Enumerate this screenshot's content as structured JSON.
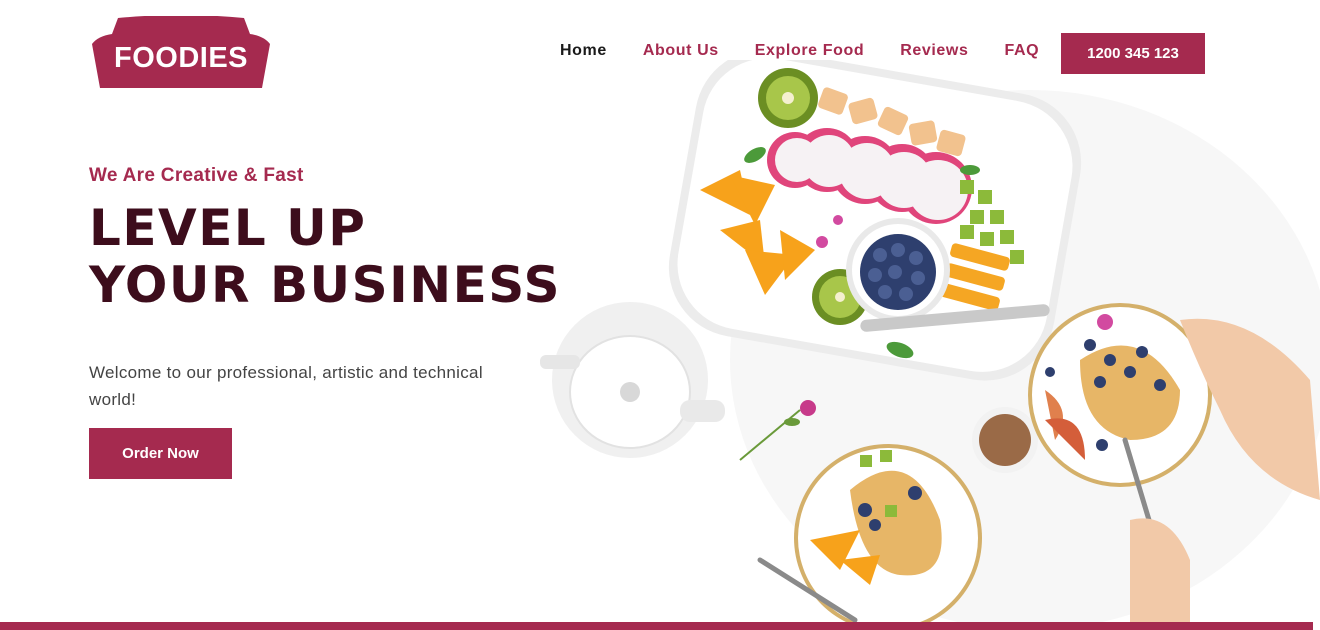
{
  "brand": {
    "logo_text": "FOODIES",
    "primary_color": "#a52a4f",
    "headline_color": "#3d0d1c"
  },
  "nav": {
    "items": [
      {
        "label": "Home",
        "active": true
      },
      {
        "label": "About Us",
        "active": false
      },
      {
        "label": "Explore Food",
        "active": false
      },
      {
        "label": "Reviews",
        "active": false
      },
      {
        "label": "FAQ",
        "active": false
      }
    ],
    "phone": "1200 345 123"
  },
  "hero": {
    "tagline": "We Are Creative & Fast",
    "headline_line1": "LEVEL UP",
    "headline_line2": "YOUR BUSINESS",
    "welcome": "Welcome to our professional, artistic and technical world!",
    "cta_label": "Order Now"
  }
}
